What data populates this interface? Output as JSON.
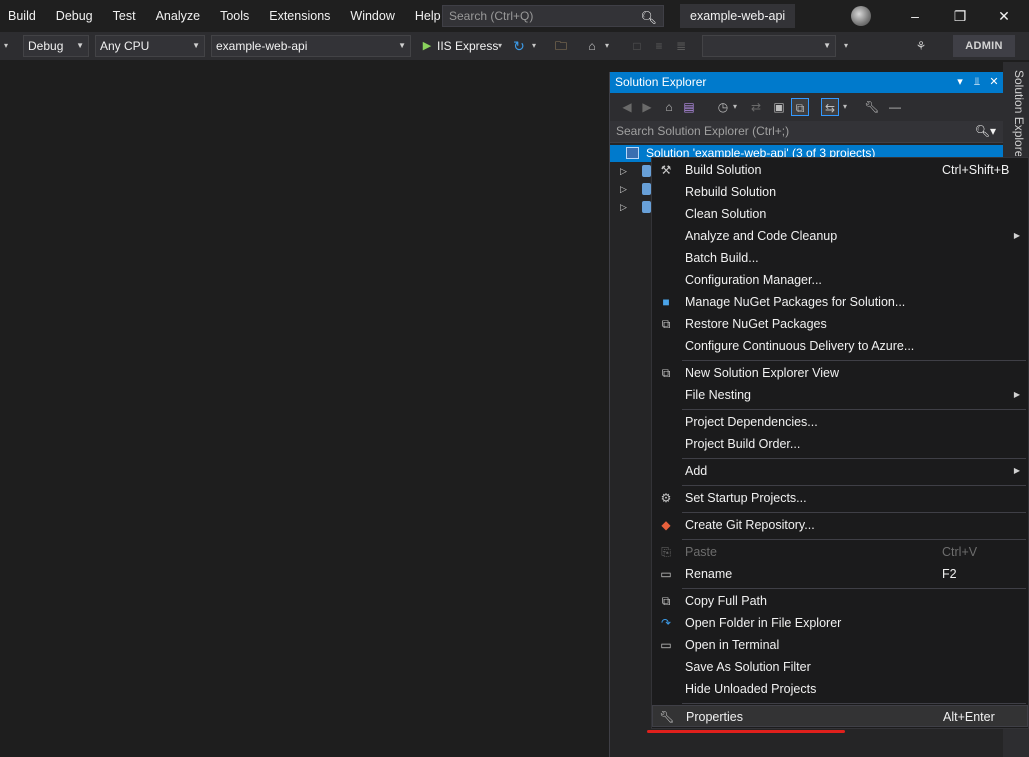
{
  "menubar": {
    "items": [
      "Build",
      "Debug",
      "Test",
      "Analyze",
      "Tools",
      "Extensions",
      "Window",
      "Help"
    ],
    "search_placeholder": "Search (Ctrl+Q)",
    "solution_name": "example-web-api"
  },
  "toolbar": {
    "configuration": "Debug",
    "platform": "Any CPU",
    "startup_project": "example-web-api",
    "run_target": "IIS Express",
    "admin_label": "ADMIN"
  },
  "solution_explorer": {
    "title": "Solution Explorer",
    "search_placeholder": "Search Solution Explorer (Ctrl+;)",
    "solution_row": "Solution 'example-web-api' (3 of 3 projects)",
    "side_tab": "Solution Explorer"
  },
  "context_menu": {
    "items": [
      {
        "label": "Build Solution",
        "shortcut": "Ctrl+Shift+B",
        "icon": "build-icon"
      },
      {
        "label": "Rebuild Solution",
        "shortcut": ""
      },
      {
        "label": "Clean Solution",
        "shortcut": ""
      },
      {
        "label": "Analyze and Code Cleanup",
        "submenu": true
      },
      {
        "label": "Batch Build...",
        "shortcut": ""
      },
      {
        "label": "Configuration Manager...",
        "shortcut": ""
      },
      {
        "label": "Manage NuGet Packages for Solution...",
        "icon": "nuget-icon"
      },
      {
        "label": "Restore NuGet Packages",
        "icon": "restore-icon"
      },
      {
        "label": "Configure Continuous Delivery to Azure...",
        "shortcut": ""
      },
      {
        "label": "New Solution Explorer View",
        "icon": "new-view-icon"
      },
      {
        "label": "File Nesting",
        "submenu": true
      },
      {
        "label": "Project Dependencies...",
        "shortcut": ""
      },
      {
        "label": "Project Build Order...",
        "shortcut": ""
      },
      {
        "label": "Add",
        "submenu": true
      },
      {
        "label": "Set Startup Projects...",
        "icon": "gear-icon"
      },
      {
        "label": "Create Git Repository...",
        "icon": "git-icon"
      },
      {
        "label": "Paste",
        "shortcut": "Ctrl+V",
        "disabled": true,
        "icon": "paste-icon"
      },
      {
        "label": "Rename",
        "shortcut": "F2",
        "icon": "rename-icon"
      },
      {
        "label": "Copy Full Path",
        "icon": "copy-icon"
      },
      {
        "label": "Open Folder in File Explorer",
        "icon": "open-folder-icon"
      },
      {
        "label": "Open in Terminal",
        "icon": "terminal-icon"
      },
      {
        "label": "Save As Solution Filter",
        "shortcut": ""
      },
      {
        "label": "Hide Unloaded Projects",
        "shortcut": ""
      },
      {
        "label": "Properties",
        "shortcut": "Alt+Enter",
        "icon": "wrench-icon",
        "highlighted": true
      }
    ]
  },
  "colors": {
    "accent": "#007acc",
    "annotation_underline": "#e0201c"
  }
}
